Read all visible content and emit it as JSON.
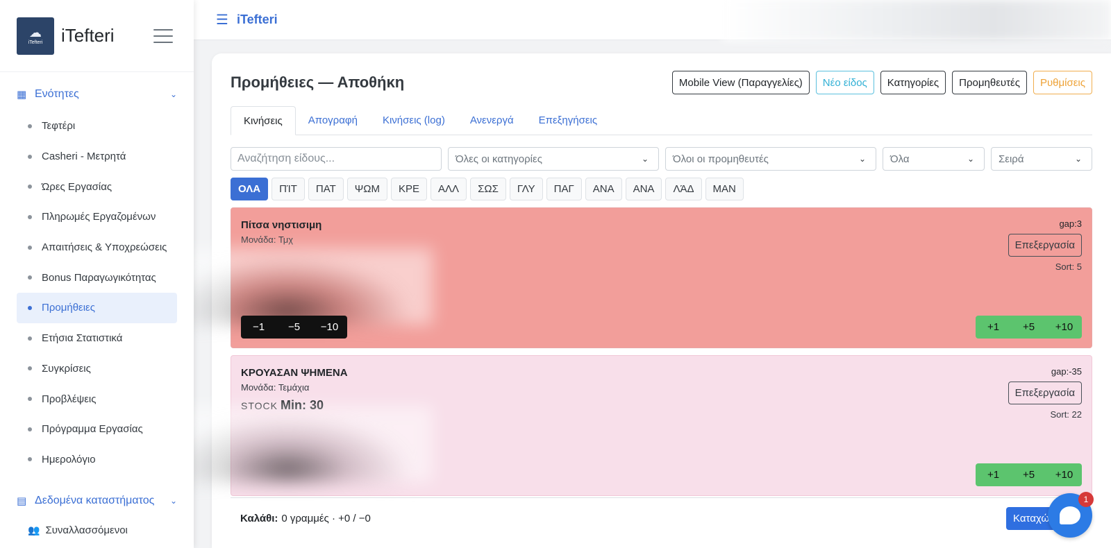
{
  "sidebar": {
    "brand": "iTefteri",
    "logo_text": "iTefteri",
    "section1": "Ενότητες",
    "items": [
      {
        "label": "Τεφτέρι"
      },
      {
        "label": "Casheri - Μετρητά"
      },
      {
        "label": "Ώρες Εργασίας"
      },
      {
        "label": "Πληρωμές Εργαζομένων"
      },
      {
        "label": "Απαιτήσεις & Υποχρεώσεις"
      },
      {
        "label": "Bonus Παραγωγικότητας"
      },
      {
        "label": "Προμήθειες",
        "active": true
      },
      {
        "label": "Ετήσια Στατιστικά"
      },
      {
        "label": "Συγκρίσεις"
      },
      {
        "label": "Προβλέψεις"
      },
      {
        "label": "Πρόγραμμα Εργασίας"
      },
      {
        "label": "Ημερολόγιο"
      }
    ],
    "section2": "Δεδομένα καταστήματος",
    "section2_items": [
      {
        "label": "Συναλλασσόμενοι"
      }
    ]
  },
  "topbar": {
    "title": "iTefteri"
  },
  "page": {
    "title": "Προμήθειες — Αποθήκη",
    "buttons": {
      "mobile": "Mobile View (Παραγγελίες)",
      "new_item": "Νέο είδος",
      "categories": "Κατηγορίες",
      "suppliers": "Προμηθευτές",
      "settings": "Ρυθμίσεις"
    },
    "tabs": [
      "Κινήσεις",
      "Απογραφή",
      "Κινήσεις (log)",
      "Ανενεργά",
      "Επεξηγήσεις"
    ],
    "filters": {
      "search_placeholder": "Αναζήτηση είδους...",
      "category": "Όλες οι κατηγορίες",
      "supplier": "Όλοι οι προμηθευτές",
      "status": "Όλα",
      "order": "Σειρά"
    },
    "chips": [
      "ΟΛΑ",
      "ΠΊΤ",
      "ΠΑΤ",
      "ΨΩΜ",
      "ΚΡΕ",
      "ΑΛΛ",
      "ΣΩΣ",
      "ΓΛΥ",
      "ΠΑΓ",
      "ΑΝΑ",
      "ΑΝΑ",
      "ΛΆΔ",
      "ΜΑΝ"
    ],
    "items": [
      {
        "name": "Πίτσα νηστισιμη",
        "unit": "Μονάδα: Τμχ",
        "gap": "gap:3",
        "sort": "Sort: 5",
        "edit": "Επεξεργασία",
        "minus": [
          "−1",
          "−5",
          "−10"
        ],
        "plus": [
          "+1",
          "+5",
          "+10"
        ]
      },
      {
        "name": "ΚΡΟΥΑΣΑΝ ΨΗΜΕΝΑ",
        "unit": "Μονάδα: Τεμάχια",
        "stock_label": "STOCK",
        "stock_min": "Min: 30",
        "gap": "gap:-35",
        "sort": "Sort: 22",
        "edit": "Επεξεργασία",
        "plus": [
          "+1",
          "+5",
          "+10"
        ]
      }
    ],
    "cart": {
      "label": "Καλάθι:",
      "summary": "0 γραμμές · +0 / −0",
      "save": "Καταχώ"
    }
  },
  "chat": {
    "badge": "1"
  },
  "colors": {
    "accent": "#3b6fd4",
    "danger_row": "#f29e9a",
    "pink_row": "#f8dfea",
    "plus_btn": "#5cc46e"
  }
}
